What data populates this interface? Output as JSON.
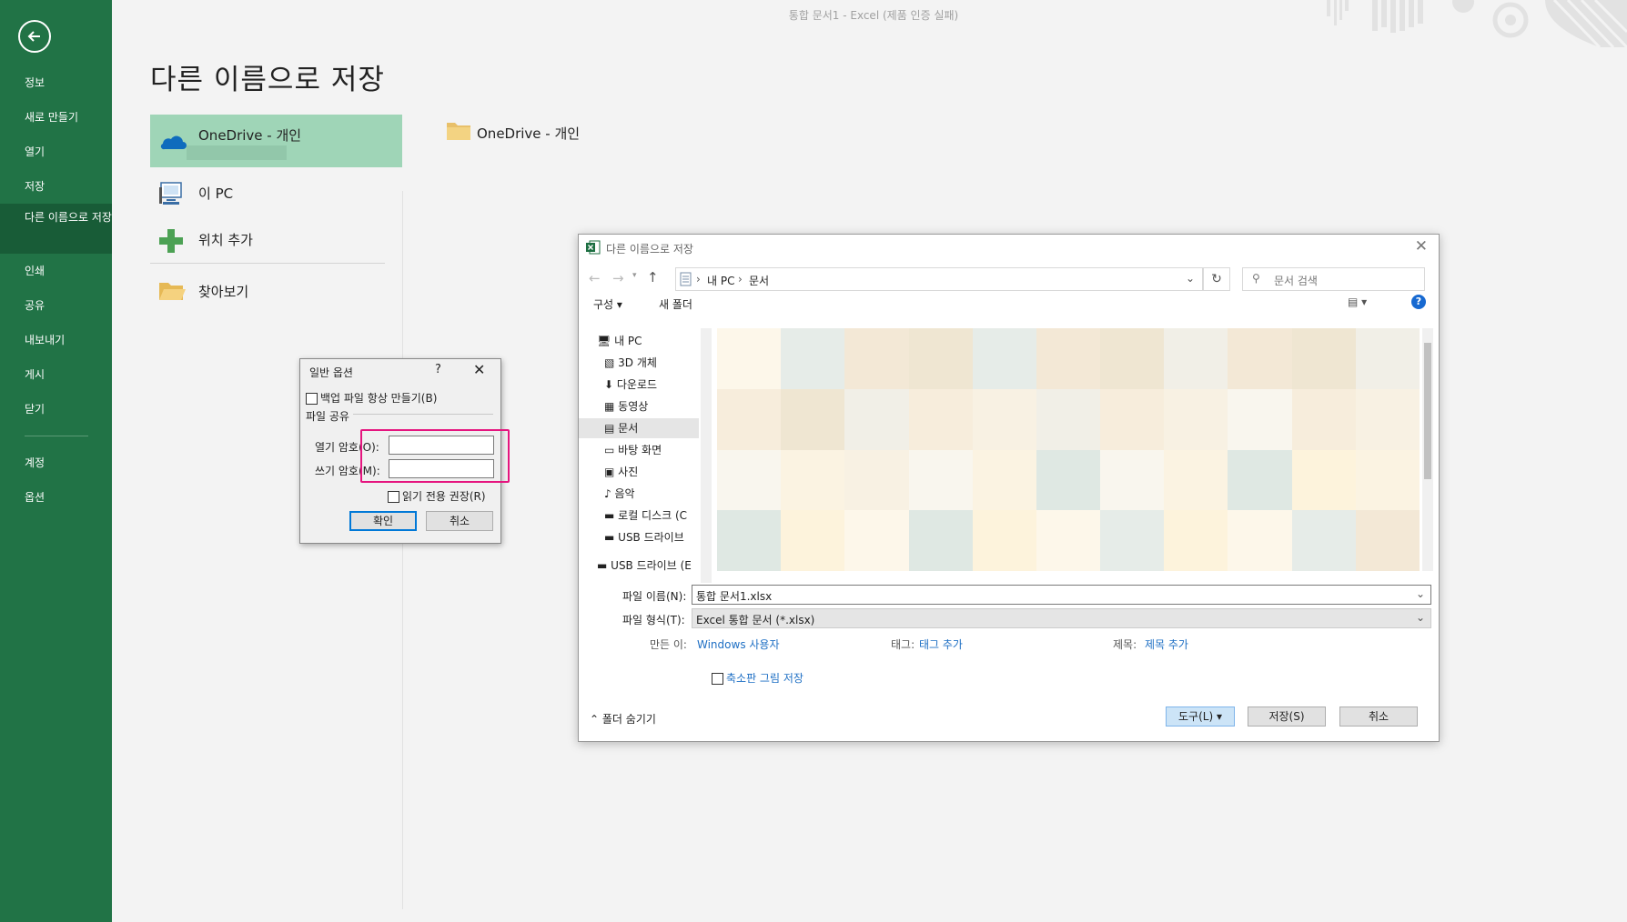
{
  "window": {
    "title": "통합 문서1 - Excel (제품 인증 실패)"
  },
  "sidebar": {
    "items": [
      {
        "label": "정보"
      },
      {
        "label": "새로 만들기"
      },
      {
        "label": "열기"
      },
      {
        "label": "저장"
      },
      {
        "label": "다른 이름으로 저장"
      },
      {
        "label": "인쇄"
      },
      {
        "label": "공유"
      },
      {
        "label": "내보내기"
      },
      {
        "label": "게시"
      },
      {
        "label": "닫기"
      },
      {
        "label": "계정"
      },
      {
        "label": "옵션"
      }
    ],
    "accent": "#217346",
    "active_bg": "#185c37"
  },
  "page": {
    "title": "다른 이름으로 저장"
  },
  "locations": {
    "onedrive": {
      "label": "OneDrive - 개인"
    },
    "this_pc": {
      "label": "이 PC"
    },
    "add_place": {
      "label": "위치 추가"
    },
    "browse": {
      "label": "찾아보기"
    }
  },
  "right_panel": {
    "folder": "OneDrive - 개인"
  },
  "general_options": {
    "title": "일반 옵션",
    "help": "?",
    "backup_label": "백업 파일 항상 만들기(B)",
    "section": "파일 공유",
    "open_pw_label": "열기 암호(O):",
    "write_pw_label": "쓰기 암호(M):",
    "open_pw_value": "",
    "write_pw_value": "",
    "readonly_label": "읽기 전용 권장(R)",
    "ok": "확인",
    "cancel": "취소"
  },
  "save_as_dialog": {
    "title": "다른 이름으로 저장",
    "path": [
      "내 PC",
      "문서"
    ],
    "search_placeholder": "문서 검색",
    "toolbar": {
      "organize": "구성",
      "new_folder": "새 폴더"
    },
    "tree": [
      {
        "label": "내 PC"
      },
      {
        "label": "3D 개체"
      },
      {
        "label": "다운로드"
      },
      {
        "label": "동영상"
      },
      {
        "label": "문서"
      },
      {
        "label": "바탕 화면"
      },
      {
        "label": "사진"
      },
      {
        "label": "음악"
      },
      {
        "label": "로컬 디스크 (C"
      },
      {
        "label": "USB 드라이브"
      },
      {
        "label": "USB 드라이브 (E"
      }
    ],
    "file_name_label": "파일 이름(N):",
    "file_name": "통합 문서1.xlsx",
    "file_type_label": "파일 형식(T):",
    "file_type": "Excel 통합 문서 (*.xlsx)",
    "author_label": "만든 이:",
    "author": "Windows 사용자",
    "tags_label": "태그:",
    "tags": "태그 추가",
    "title_label": "제목:",
    "title_value": "제목 추가",
    "thumbnail_label": "축소판 그림 저장",
    "hide_folders": "폴더 숨기기",
    "tools": "도구(L)",
    "save": "저장(S)",
    "cancel": "취소"
  }
}
